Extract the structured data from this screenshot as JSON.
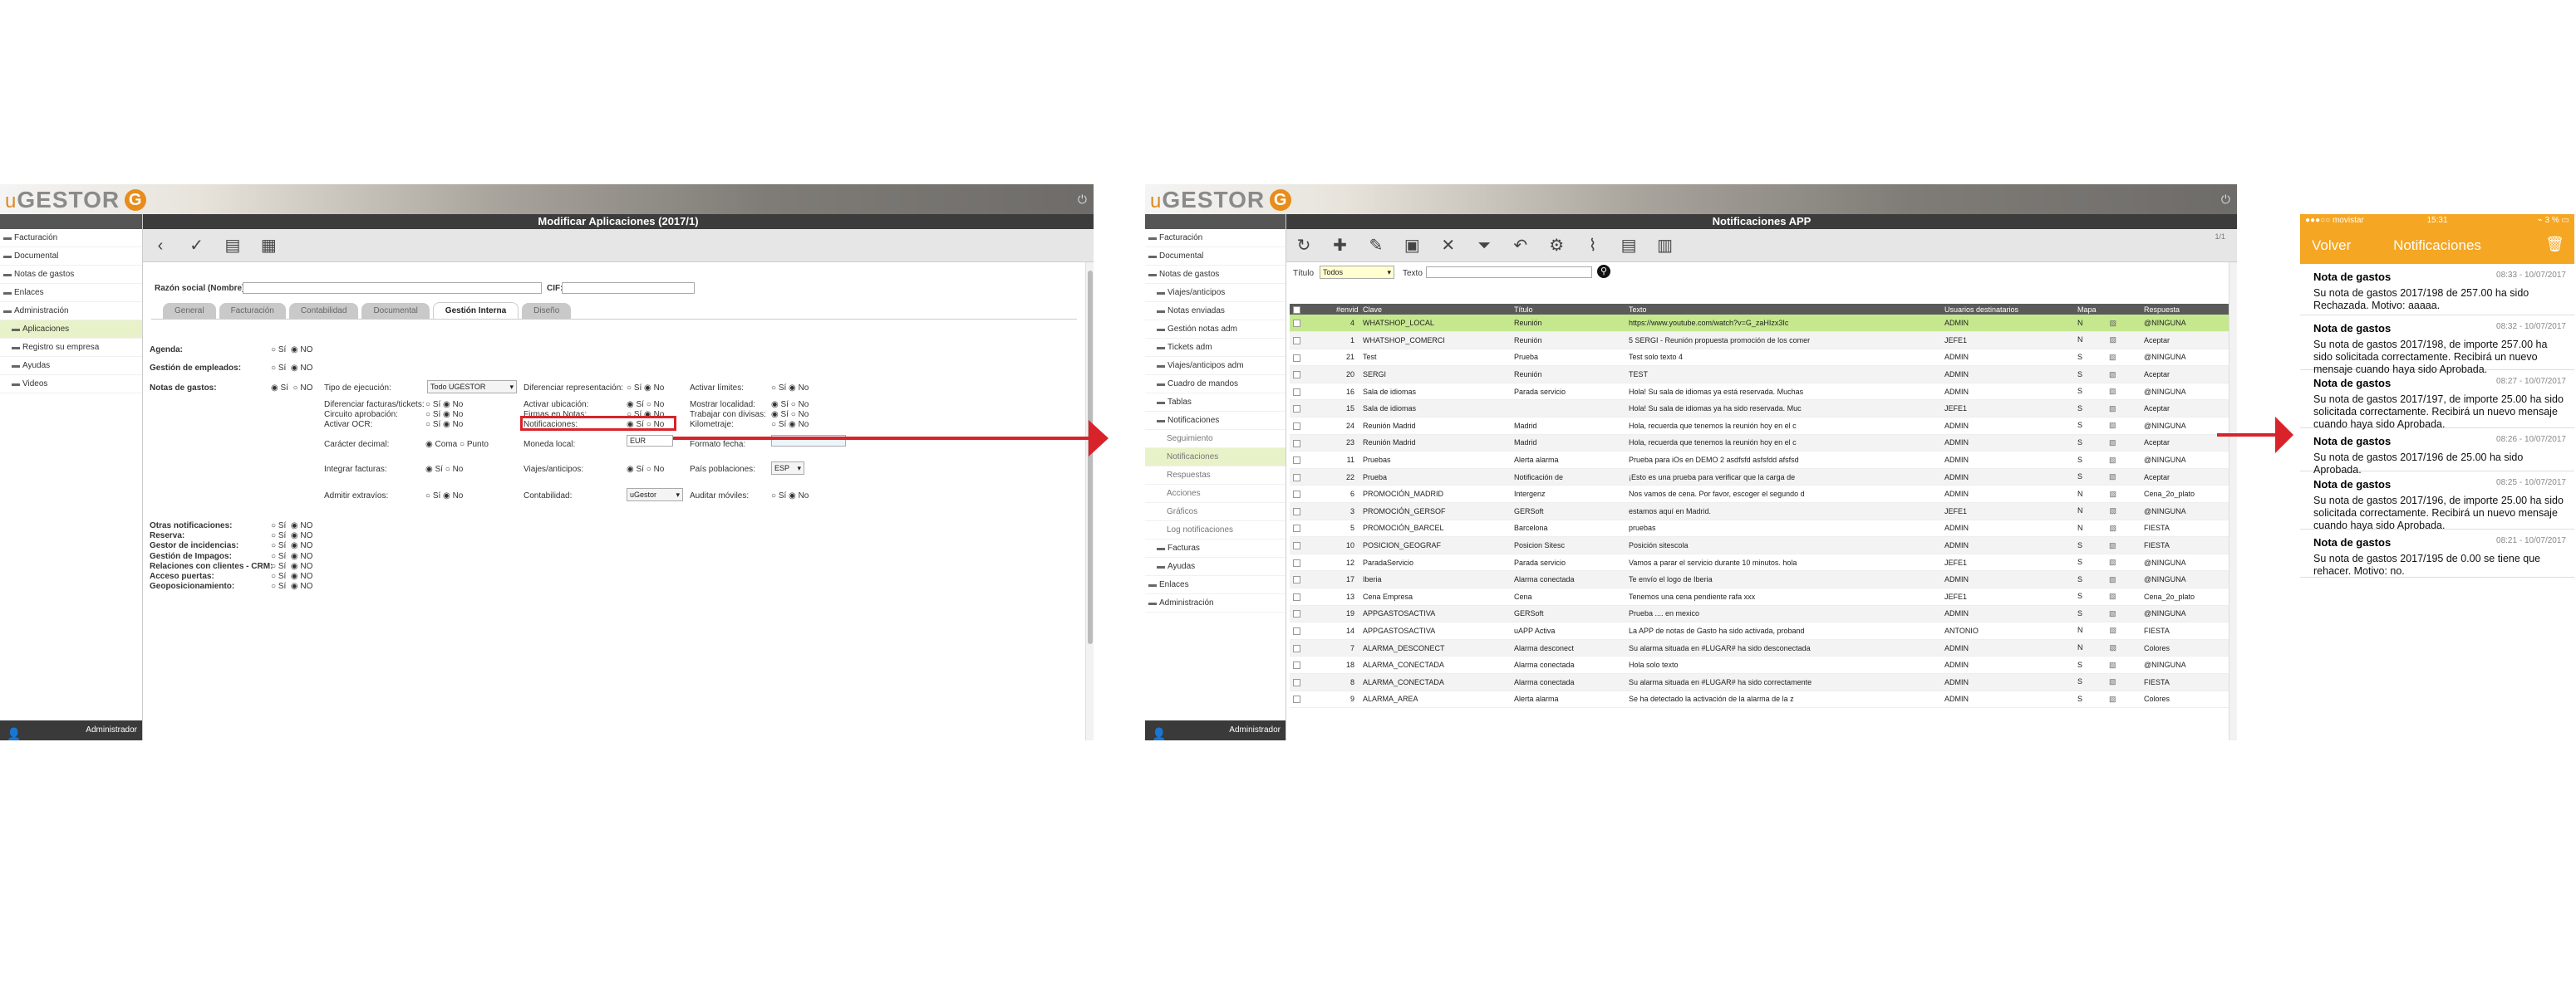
{
  "colors": {
    "accent": "#e08a1e",
    "red": "#d8232a",
    "highlight": "#c5e88e",
    "phone_orange": "#f5a623"
  },
  "logo": {
    "u": "u",
    "name": "GESTOR",
    "g": "G"
  },
  "screen1": {
    "title": "Modificar Aplicaciones (2017/1)",
    "sidebar": [
      {
        "label": "Facturación",
        "level": 0
      },
      {
        "label": "Documental",
        "level": 0
      },
      {
        "label": "Notas de gastos",
        "level": 0
      },
      {
        "label": "Enlaces",
        "level": 0
      },
      {
        "label": "Administración",
        "level": 0
      },
      {
        "label": "Aplicaciones",
        "level": 1,
        "active": true
      },
      {
        "label": "Registro su empresa",
        "level": 1
      },
      {
        "label": "Ayudas",
        "level": 1
      },
      {
        "label": "Videos",
        "level": 1
      }
    ],
    "footer_user": "Administrador",
    "razon_label": "Razón social (Nombre):",
    "cif_label": "CIF:",
    "tabs": [
      "General",
      "Facturación",
      "Contabilidad",
      "Documental",
      "Gestión Interna",
      "Diseño"
    ],
    "active_tab": "Gestión Interna",
    "agenda": "Agenda:",
    "gestion_empleados": "Gestión de empleados:",
    "notas_gastos": "Notas de gastos:",
    "si": "Sí",
    "no": "No",
    "NO": "NO",
    "tipo_ejecucion": "Tipo de ejecución:",
    "tipo_value": "Todo UGESTOR",
    "diferenciar_rep": "Diferenciar representación:",
    "activar_limites": "Activar límites:",
    "diferenciar_fact": "Diferenciar facturas/tickets:",
    "activar_ubicacion": "Activar ubicación:",
    "mostrar_localidad": "Mostrar localidad:",
    "circuito": "Circuito aprobación:",
    "firmas": "Firmas en Notas:",
    "trabajar_divisas": "Trabajar con divisas:",
    "activar_ocr": "Activar OCR:",
    "notificaciones": "Notificaciones:",
    "kilometraje": "Kilometraje:",
    "caracter_decimal": "Carácter decimal:",
    "coma": "Coma",
    "punto": "Punto",
    "moneda_local": "Moneda local:",
    "moneda_value": "EUR",
    "formato_fecha": "Formato fecha:",
    "integrar_facturas": "Integrar facturas:",
    "viajes_anticipos": "Viajes/anticipos:",
    "pais_poblaciones": "País poblaciones:",
    "pais_value": "ESP",
    "admitir_extravios": "Admitir extravíos:",
    "contabilidad": "Contabilidad:",
    "contab_value": "uGestor",
    "auditar_moviles": "Auditar móviles:",
    "otras": [
      "Otras notificaciones:",
      "Reserva:",
      "Gestor de incidencias:",
      "Gestión de Impagos:",
      "Relaciones con clientes - CRM:",
      "Acceso puertas:",
      "Geoposicionamiento:"
    ]
  },
  "screen2": {
    "title": "Notificaciones APP",
    "sidebar": [
      {
        "label": "Facturación",
        "level": 0
      },
      {
        "label": "Documental",
        "level": 0
      },
      {
        "label": "Notas de gastos",
        "level": 0
      },
      {
        "label": "Viajes/anticipos",
        "level": 1
      },
      {
        "label": "Notas enviadas",
        "level": 1
      },
      {
        "label": "Gestión notas adm",
        "level": 1
      },
      {
        "label": "Tickets adm",
        "level": 1
      },
      {
        "label": "Viajes/anticipos adm",
        "level": 1
      },
      {
        "label": "Cuadro de mandos",
        "level": 1
      },
      {
        "label": "Tablas",
        "level": 1
      },
      {
        "label": "Notificaciones",
        "level": 1
      },
      {
        "label": "Seguimiento",
        "level": 2
      },
      {
        "label": "Notificaciones",
        "level": 2,
        "active": true
      },
      {
        "label": "Respuestas",
        "level": 2
      },
      {
        "label": "Acciones",
        "level": 2
      },
      {
        "label": "Gráficos",
        "level": 2
      },
      {
        "label": "Log notificaciones",
        "level": 2
      },
      {
        "label": "Facturas",
        "level": 1
      },
      {
        "label": "Ayudas",
        "level": 1
      },
      {
        "label": "Enlaces",
        "level": 0
      },
      {
        "label": "Administración",
        "level": 0
      }
    ],
    "footer_user": "Administrador",
    "filter_titulo": "Título",
    "filter_titulo_value": "Todos",
    "filter_texto": "Texto",
    "page_indicator": "1/1",
    "columns": [
      "",
      "#envid",
      "Clave",
      "Título",
      "Texto",
      "Usuarios destinatarios",
      "Mapa",
      "Respuesta"
    ],
    "rows": [
      [
        "4",
        "WHATSHOP_LOCAL",
        "Reunión",
        "https://www.youtube.com/watch?v=G_zaHIzx3Ic",
        "ADMIN",
        "N",
        "@NINGUNA"
      ],
      [
        "1",
        "WHATSHOP_COMERCI",
        "Reunión",
        "5 SERGI - Reunión propuesta promoción de los comer",
        "JEFE1",
        "N",
        "Aceptar"
      ],
      [
        "21",
        "Test",
        "Prueba",
        "Test solo texto 4",
        "ADMIN",
        "S",
        "@NINGUNA"
      ],
      [
        "20",
        "SERGI",
        "Reunión",
        "TEST",
        "ADMIN",
        "S",
        "Aceptar"
      ],
      [
        "16",
        "Sala de idiomas",
        "Parada servicio",
        "Hola! Su sala de idiomas ya está reservada. Muchas",
        "ADMIN",
        "S",
        "@NINGUNA"
      ],
      [
        "15",
        "Sala de idiomas",
        "",
        "Hola! Su sala de idiomas ya ha sido reservada. Muc",
        "JEFE1",
        "S",
        "Aceptar"
      ],
      [
        "24",
        "Reunión Madrid",
        "Madrid",
        "Hola, recuerda que tenemos la reunión hoy en el c",
        "ADMIN",
        "S",
        "@NINGUNA"
      ],
      [
        "23",
        "Reunión Madrid",
        "Madrid",
        "Hola, recuerda que tenemos la reunión hoy en el c",
        "ADMIN",
        "S",
        "Aceptar"
      ],
      [
        "11",
        "Pruebas",
        "Alerta alarma",
        "Prueba para iOs en DEMO 2 asdfsfd asfsfdd afsfsd",
        "ADMIN",
        "S",
        "@NINGUNA"
      ],
      [
        "22",
        "Prueba",
        "Notificación de",
        "¡Esto es una prueba para verificar que la carga de",
        "ADMIN",
        "S",
        "Aceptar"
      ],
      [
        "6",
        "PROMOCIÓN_MADRID",
        "Intergenz",
        "Nos vamos de cena. Por favor, escoger el segundo d",
        "ADMIN",
        "N",
        "Cena_2o_plato"
      ],
      [
        "3",
        "PROMOCIÓN_GERSOF",
        "GERSoft",
        "estamos aquí en Madrid.",
        "JEFE1",
        "N",
        "@NINGUNA"
      ],
      [
        "5",
        "PROMOCIÓN_BARCEL",
        "Barcelona",
        "pruebas",
        "ADMIN",
        "N",
        "FIESTA"
      ],
      [
        "10",
        "POSICION_GEOGRAF",
        "Posicion Sitesc",
        "Posición sitescola",
        "ADMIN",
        "S",
        "FIESTA"
      ],
      [
        "12",
        "ParadaServicio",
        "Parada servicio",
        "Vamos a parar el servicio durante 10 minutos. hola",
        "JEFE1",
        "S",
        "@NINGUNA"
      ],
      [
        "17",
        "Iberia",
        "Alarma conectada",
        "Te envío el logo de Iberia",
        "ADMIN",
        "S",
        "@NINGUNA"
      ],
      [
        "13",
        "Cena Empresa",
        "Cena",
        "Tenemos una cena pendiente rafa xxx",
        "JEFE1",
        "S",
        "Cena_2o_plato"
      ],
      [
        "19",
        "APPGASTOSACTIVA",
        "GERSoft",
        "Prueba .... en mexico",
        "ADMIN",
        "S",
        "@NINGUNA"
      ],
      [
        "14",
        "APPGASTOSACTIVA",
        "uAPP Activa",
        "La APP de notas de Gasto ha sido activada, proband",
        "ANTONIO",
        "N",
        "FIESTA"
      ],
      [
        "7",
        "ALARMA_DESCONECT",
        "Alarma desconect",
        "Su alarma situada en #LUGAR# ha sido desconectada",
        "ADMIN",
        "N",
        "Colores"
      ],
      [
        "18",
        "ALARMA_CONECTADA",
        "Alarma conectada",
        "Hola solo texto",
        "ADMIN",
        "S",
        "@NINGUNA"
      ],
      [
        "8",
        "ALARMA_CONECTADA",
        "Alarma conectada",
        "Su alarma situada en #LUGAR# ha sido correctamente",
        "ADMIN",
        "S",
        "FIESTA"
      ],
      [
        "9",
        "ALARMA_AREA",
        "Alerta alarma",
        "Se ha detectado la activación de la alarma de la z",
        "ADMIN",
        "S",
        "Colores"
      ]
    ]
  },
  "phone": {
    "status_left": "●●●○○ movistar",
    "status_time": "15:31",
    "status_right": "⌁ 3 % ▭",
    "back": "Volver",
    "title": "Notificaciones",
    "notes": [
      {
        "title": "Nota de gastos",
        "date": "08:33 - 10/07/2017",
        "text": "Su nota de gastos 2017/198 de 257.00 ha sido Rechazada. Motivo: aaaaa."
      },
      {
        "title": "Nota de gastos",
        "date": "08:32 - 10/07/2017",
        "text": "Su nota de gastos 2017/198, de importe 257.00  ha sido solicitada correctamente. Recibirá un nuevo mensaje cuando haya sido Aprobada."
      },
      {
        "title": "Nota de gastos",
        "date": "08:27 - 10/07/2017",
        "text": "Su nota de gastos 2017/197, de importe 25.00  ha sido solicitada correctamente. Recibirá un nuevo mensaje cuando haya sido Aprobada."
      },
      {
        "title": "Nota de gastos",
        "date": "08:26 - 10/07/2017",
        "text": "Su nota de gastos 2017/196 de 25.00 ha sido Aprobada."
      },
      {
        "title": "Nota de gastos",
        "date": "08:25 - 10/07/2017",
        "text": "Su nota de gastos 2017/196, de importe 25.00  ha sido solicitada correctamente. Recibirá un nuevo mensaje cuando haya sido Aprobada."
      },
      {
        "title": "Nota de gastos",
        "date": "08:21 - 10/07/2017",
        "text": "Su nota de gastos 2017/195 de 0.00 se tiene que rehacer. Motivo: no."
      }
    ]
  }
}
